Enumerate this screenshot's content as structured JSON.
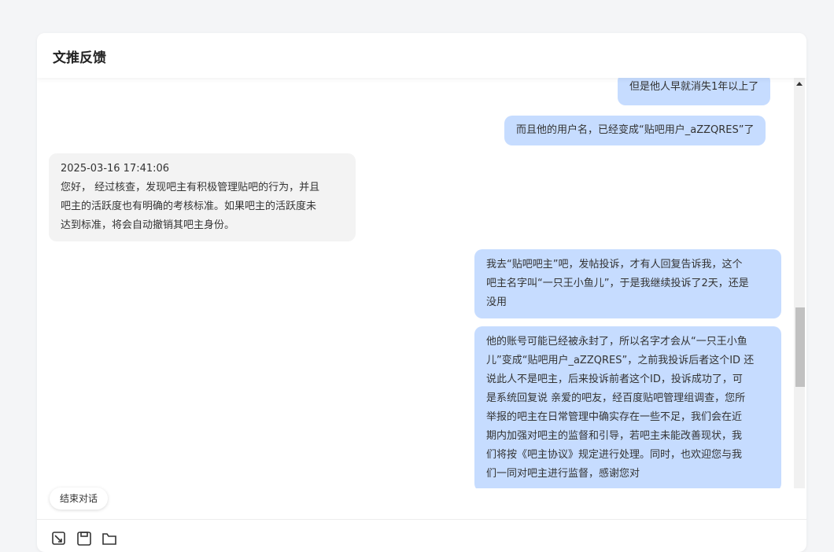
{
  "header": {
    "title": "文推反馈"
  },
  "messages": [
    {
      "role": "user",
      "lines": [
        "但是他人早就消失1年以上了"
      ]
    },
    {
      "role": "user",
      "lines": [
        "而且他的用户名，已经变成“贴吧用户_aZZQRES”了"
      ]
    },
    {
      "role": "agent",
      "timestamp": "2025-03-16 17:41:06",
      "lines": [
        "您好， 经过核查，发现吧主有积极管理贴吧的行为，并且",
        "吧主的活跃度也有明确的考核标准。如果吧主的活跃度未",
        "达到标准，将会自动撤销其吧主身份。"
      ]
    },
    {
      "role": "user",
      "lines": [
        "我去“贴吧吧主”吧，发帖投诉，才有人回复告诉我，这个",
        "吧主名字叫“一只王小鱼儿”，于是我继续投诉了2天，还是",
        "没用"
      ]
    },
    {
      "role": "user",
      "lines": [
        "他的账号可能已经被永封了，所以名字才会从“一只王小鱼",
        "儿”变成“贴吧用户_aZZQRES”，之前我投诉后者这个ID 还",
        "说此人不是吧主，后来投诉前者这个ID，投诉成功了，可",
        "是系统回复说 亲爱的吧友，经百度贴吧管理组调查，您所",
        "举报的吧主在日常管理中确实存在一些不足，我们会在近",
        "期内加强对吧主的监督和引导，若吧主未能改善现状，我",
        "们将按《吧主协议》规定进行处理。同时，也欢迎您与我",
        "们一同对吧主进行监督，感谢您对"
      ]
    }
  ],
  "actions": {
    "end_chat_label": "结束对话"
  },
  "toolbar": [
    "image-icon",
    "save-icon",
    "folder-icon"
  ],
  "colors": {
    "user_bubble": "#c6dcff",
    "agent_bubble": "#f3f3f3",
    "background": "#f4f5f7"
  }
}
